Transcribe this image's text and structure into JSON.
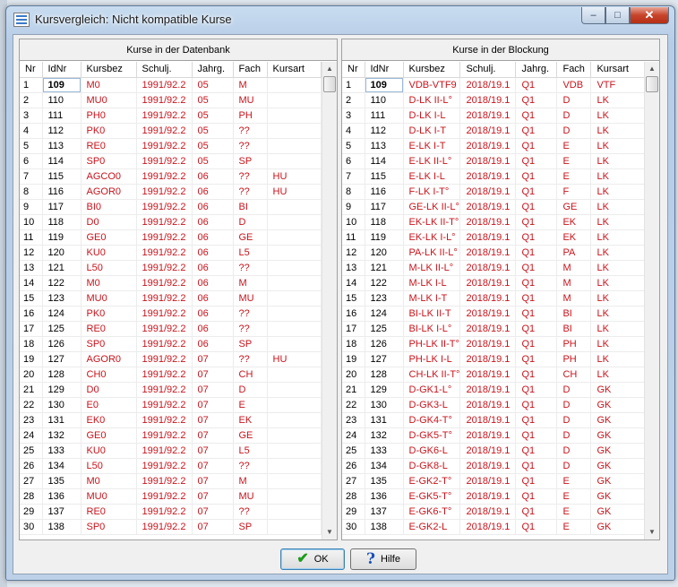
{
  "window": {
    "title": "Kursvergleich: Nicht kompatible Kurse",
    "controls": {
      "minimize": "–",
      "maximize": "□",
      "close": "✕"
    }
  },
  "left_panel": {
    "title": "Kurse in der Datenbank",
    "columns": [
      "Nr",
      "IdNr",
      "Kursbez",
      "Schulj.",
      "Jahrg.",
      "Fach",
      "Kursart"
    ],
    "rows": [
      [
        "1",
        "109",
        "M0",
        "1991/92.2",
        "05",
        "M",
        ""
      ],
      [
        "2",
        "110",
        "MU0",
        "1991/92.2",
        "05",
        "MU",
        ""
      ],
      [
        "3",
        "111",
        "PH0",
        "1991/92.2",
        "05",
        "PH",
        ""
      ],
      [
        "4",
        "112",
        "PK0",
        "1991/92.2",
        "05",
        "??",
        ""
      ],
      [
        "5",
        "113",
        "RE0",
        "1991/92.2",
        "05",
        "??",
        ""
      ],
      [
        "6",
        "114",
        "SP0",
        "1991/92.2",
        "05",
        "SP",
        ""
      ],
      [
        "7",
        "115",
        "AGCO0",
        "1991/92.2",
        "06",
        "??",
        "HU"
      ],
      [
        "8",
        "116",
        "AGOR0",
        "1991/92.2",
        "06",
        "??",
        "HU"
      ],
      [
        "9",
        "117",
        "BI0",
        "1991/92.2",
        "06",
        "BI",
        ""
      ],
      [
        "10",
        "118",
        "D0",
        "1991/92.2",
        "06",
        "D",
        ""
      ],
      [
        "11",
        "119",
        "GE0",
        "1991/92.2",
        "06",
        "GE",
        ""
      ],
      [
        "12",
        "120",
        "KU0",
        "1991/92.2",
        "06",
        "L5",
        ""
      ],
      [
        "13",
        "121",
        "L50",
        "1991/92.2",
        "06",
        "??",
        ""
      ],
      [
        "14",
        "122",
        "M0",
        "1991/92.2",
        "06",
        "M",
        ""
      ],
      [
        "15",
        "123",
        "MU0",
        "1991/92.2",
        "06",
        "MU",
        ""
      ],
      [
        "16",
        "124",
        "PK0",
        "1991/92.2",
        "06",
        "??",
        ""
      ],
      [
        "17",
        "125",
        "RE0",
        "1991/92.2",
        "06",
        "??",
        ""
      ],
      [
        "18",
        "126",
        "SP0",
        "1991/92.2",
        "06",
        "SP",
        ""
      ],
      [
        "19",
        "127",
        "AGOR0",
        "1991/92.2",
        "07",
        "??",
        "HU"
      ],
      [
        "20",
        "128",
        "CH0",
        "1991/92.2",
        "07",
        "CH",
        ""
      ],
      [
        "21",
        "129",
        "D0",
        "1991/92.2",
        "07",
        "D",
        ""
      ],
      [
        "22",
        "130",
        "E0",
        "1991/92.2",
        "07",
        "E",
        ""
      ],
      [
        "23",
        "131",
        "EK0",
        "1991/92.2",
        "07",
        "EK",
        ""
      ],
      [
        "24",
        "132",
        "GE0",
        "1991/92.2",
        "07",
        "GE",
        ""
      ],
      [
        "25",
        "133",
        "KU0",
        "1991/92.2",
        "07",
        "L5",
        ""
      ],
      [
        "26",
        "134",
        "L50",
        "1991/92.2",
        "07",
        "??",
        ""
      ],
      [
        "27",
        "135",
        "M0",
        "1991/92.2",
        "07",
        "M",
        ""
      ],
      [
        "28",
        "136",
        "MU0",
        "1991/92.2",
        "07",
        "MU",
        ""
      ],
      [
        "29",
        "137",
        "RE0",
        "1991/92.2",
        "07",
        "??",
        ""
      ],
      [
        "30",
        "138",
        "SP0",
        "1991/92.2",
        "07",
        "SP",
        ""
      ]
    ]
  },
  "right_panel": {
    "title": "Kurse in der Blockung",
    "columns": [
      "Nr",
      "IdNr",
      "Kursbez",
      "Schulj.",
      "Jahrg.",
      "Fach",
      "Kursart"
    ],
    "rows": [
      [
        "1",
        "109",
        "VDB-VTF9",
        "2018/19.1",
        "Q1",
        "VDB",
        "VTF"
      ],
      [
        "2",
        "110",
        "D-LK II-L°",
        "2018/19.1",
        "Q1",
        "D",
        "LK"
      ],
      [
        "3",
        "111",
        "D-LK I-L",
        "2018/19.1",
        "Q1",
        "D",
        "LK"
      ],
      [
        "4",
        "112",
        "D-LK I-T",
        "2018/19.1",
        "Q1",
        "D",
        "LK"
      ],
      [
        "5",
        "113",
        "E-LK I-T",
        "2018/19.1",
        "Q1",
        "E",
        "LK"
      ],
      [
        "6",
        "114",
        "E-LK II-L°",
        "2018/19.1",
        "Q1",
        "E",
        "LK"
      ],
      [
        "7",
        "115",
        "E-LK I-L",
        "2018/19.1",
        "Q1",
        "E",
        "LK"
      ],
      [
        "8",
        "116",
        "F-LK I-T°",
        "2018/19.1",
        "Q1",
        "F",
        "LK"
      ],
      [
        "9",
        "117",
        "GE-LK II-L°",
        "2018/19.1",
        "Q1",
        "GE",
        "LK"
      ],
      [
        "10",
        "118",
        "EK-LK II-T°",
        "2018/19.1",
        "Q1",
        "EK",
        "LK"
      ],
      [
        "11",
        "119",
        "EK-LK I-L°",
        "2018/19.1",
        "Q1",
        "EK",
        "LK"
      ],
      [
        "12",
        "120",
        "PA-LK II-L°",
        "2018/19.1",
        "Q1",
        "PA",
        "LK"
      ],
      [
        "13",
        "121",
        "M-LK II-L°",
        "2018/19.1",
        "Q1",
        "M",
        "LK"
      ],
      [
        "14",
        "122",
        "M-LK I-L",
        "2018/19.1",
        "Q1",
        "M",
        "LK"
      ],
      [
        "15",
        "123",
        "M-LK I-T",
        "2018/19.1",
        "Q1",
        "M",
        "LK"
      ],
      [
        "16",
        "124",
        "BI-LK II-T",
        "2018/19.1",
        "Q1",
        "BI",
        "LK"
      ],
      [
        "17",
        "125",
        "BI-LK I-L°",
        "2018/19.1",
        "Q1",
        "BI",
        "LK"
      ],
      [
        "18",
        "126",
        "PH-LK II-T°",
        "2018/19.1",
        "Q1",
        "PH",
        "LK"
      ],
      [
        "19",
        "127",
        "PH-LK I-L",
        "2018/19.1",
        "Q1",
        "PH",
        "LK"
      ],
      [
        "20",
        "128",
        "CH-LK II-T°",
        "2018/19.1",
        "Q1",
        "CH",
        "LK"
      ],
      [
        "21",
        "129",
        "D-GK1-L°",
        "2018/19.1",
        "Q1",
        "D",
        "GK"
      ],
      [
        "22",
        "130",
        "D-GK3-L",
        "2018/19.1",
        "Q1",
        "D",
        "GK"
      ],
      [
        "23",
        "131",
        "D-GK4-T°",
        "2018/19.1",
        "Q1",
        "D",
        "GK"
      ],
      [
        "24",
        "132",
        "D-GK5-T°",
        "2018/19.1",
        "Q1",
        "D",
        "GK"
      ],
      [
        "25",
        "133",
        "D-GK6-L",
        "2018/19.1",
        "Q1",
        "D",
        "GK"
      ],
      [
        "26",
        "134",
        "D-GK8-L",
        "2018/19.1",
        "Q1",
        "D",
        "GK"
      ],
      [
        "27",
        "135",
        "E-GK2-T°",
        "2018/19.1",
        "Q1",
        "E",
        "GK"
      ],
      [
        "28",
        "136",
        "E-GK5-T°",
        "2018/19.1",
        "Q1",
        "E",
        "GK"
      ],
      [
        "29",
        "137",
        "E-GK6-T°",
        "2018/19.1",
        "Q1",
        "E",
        "GK"
      ],
      [
        "30",
        "138",
        "E-GK2-L",
        "2018/19.1",
        "Q1",
        "E",
        "GK"
      ]
    ]
  },
  "buttons": {
    "ok": "OK",
    "help": "Hilfe"
  },
  "colors": {
    "value_text": "#c8141c",
    "number_text": "#000000"
  }
}
